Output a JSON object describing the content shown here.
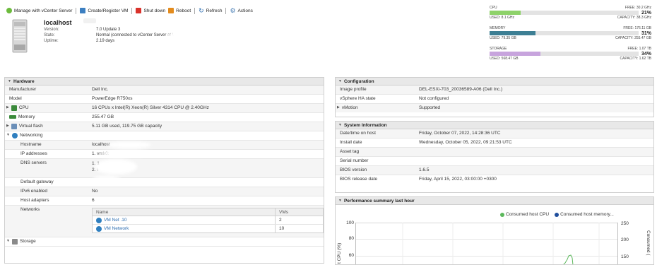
{
  "toolbar": {
    "manage_label": "Manage with vCenter Server",
    "create_label": "Create/Register VM",
    "shutdown_label": "Shut down",
    "reboot_label": "Reboot",
    "refresh_label": "Refresh",
    "actions_label": "Actions"
  },
  "host": {
    "name": "localhost",
    "version_label": "Version:",
    "version_value": "7.0 Update 3",
    "state_label": "State:",
    "state_value": "Normal (connected to vCenter Server at \\",
    "uptime_label": "Uptime:",
    "uptime_value": "2.19 days"
  },
  "resources": {
    "cpu": {
      "label": "CPU",
      "free": "FREE: 30.2 GHz",
      "percent": "21%",
      "fraction": 0.21,
      "used": "USED: 8.1 GHz",
      "capacity": "CAPACITY: 38.3 GHz",
      "color": "#8ed26a"
    },
    "memory": {
      "label": "MEMORY",
      "free": "FREE: 176.11 GB",
      "percent": "31%",
      "fraction": 0.31,
      "used": "USED: 79.35 GB",
      "capacity": "CAPACITY: 255.47 GB",
      "color": "#3d7f94"
    },
    "storage": {
      "label": "STORAGE",
      "free": "FREE: 1.07 TB",
      "percent": "34%",
      "fraction": 0.34,
      "used": "USED: 568.47 GB",
      "capacity": "CAPACITY: 1.62 TB",
      "color": "#c7a4dd"
    }
  },
  "hardware": {
    "title": "Hardware",
    "manufacturer_label": "Manufacturer",
    "manufacturer_value": "Dell Inc.",
    "model_label": "Model",
    "model_value": "PowerEdge R750xs",
    "cpu_label": "CPU",
    "cpu_value": "16 CPUs x Intel(R) Xeon(R) Silver 4314 CPU @ 2.40GHz",
    "memory_label": "Memory",
    "memory_value": "255.47 GB",
    "flash_label": "Virtual flash",
    "flash_value": "5.11 GB used, 119.75 GB capacity",
    "networking_label": "Networking",
    "hostname_label": "Hostname",
    "hostname_value": "localhost",
    "ip_label": "IP addresses",
    "ip_value": "1. vmk0:",
    "dns_label": "DNS servers",
    "dns_value_1": "1. 1",
    "dns_value_2": "2. \\",
    "gateway_label": "Default gateway",
    "ipv6_label": "IPv6 enabled",
    "ipv6_value": "No",
    "adapters_label": "Host adapters",
    "adapters_value": "6",
    "networks_label": "Networks",
    "networks_table": {
      "col_name": "Name",
      "col_vms": "VMs",
      "rows": [
        {
          "name": "VM Net .10",
          "vms": "2"
        },
        {
          "name": "VM Network",
          "vms": "10"
        }
      ]
    },
    "storage_label": "Storage"
  },
  "configuration": {
    "title": "Configuration",
    "image_label": "Image profile",
    "image_value": "DEL-ESXi-703_20036589-A06 (Dell Inc.)",
    "ha_label": "vSphere HA state",
    "ha_value": "Not configured",
    "vmotion_label": "vMotion",
    "vmotion_value": "Supported"
  },
  "system": {
    "title": "System Information",
    "datetime_label": "Date/time on host",
    "datetime_value": "Friday, October 07, 2022, 14:28:36 UTC",
    "install_label": "Install date",
    "install_value": "Wednesday, October 05, 2022, 09:21:53 UTC",
    "asset_label": "Asset tag",
    "serial_label": "Serial number",
    "serial_value": "",
    "bios_label": "BIOS version",
    "bios_value": "1.6.5",
    "bios_date_label": "BIOS release date",
    "bios_date_value": "Friday, April 15, 2022, 03:00:00 +0300"
  },
  "performance": {
    "title": "Performance summary last hour",
    "legend_cpu": "Consumed host CPU",
    "legend_mem": "Consumed host memory...",
    "legend_cpu_color": "#5cb85c",
    "legend_mem_color": "#1f4e9c",
    "y_left_label": "t CPU (%)",
    "y_right_label": "Consumed (",
    "left_ticks": [
      "100",
      "80",
      "60"
    ],
    "right_ticks": [
      "250",
      "200",
      "150"
    ]
  }
}
